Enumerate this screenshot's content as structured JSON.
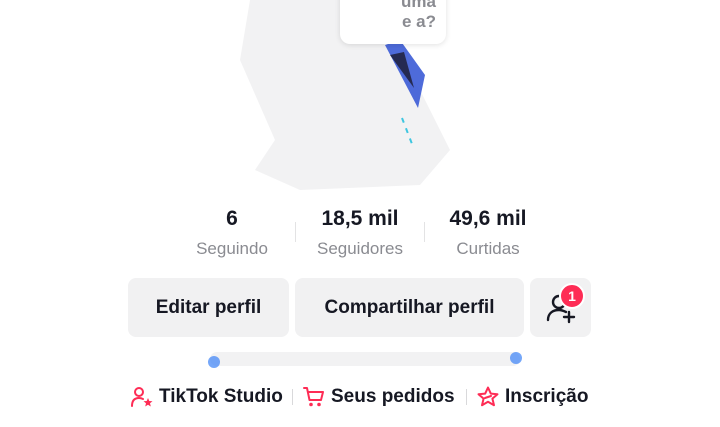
{
  "profile_note": {
    "line1": "uma",
    "line2": "e a?"
  },
  "stats": {
    "following": {
      "value": "6",
      "label": "Seguindo"
    },
    "followers": {
      "value": "18,5 mil",
      "label": "Seguidores"
    },
    "likes": {
      "value": "49,6 mil",
      "label": "Curtidas"
    }
  },
  "actions": {
    "edit_profile": "Editar perfil",
    "share_profile": "Compartilhar perfil",
    "friend_requests_badge": "1"
  },
  "links": {
    "studio": {
      "label": "TikTok Studio",
      "icon": "person-star-icon"
    },
    "orders": {
      "label": "Seus pedidos",
      "icon": "cart-icon"
    },
    "subscription": {
      "label": "Inscrição",
      "icon": "star-outline-icon"
    }
  },
  "colors": {
    "accent": "#fe2c55",
    "text": "#161823",
    "muted": "#8a8b91",
    "button_bg": "#f1f1f2"
  }
}
